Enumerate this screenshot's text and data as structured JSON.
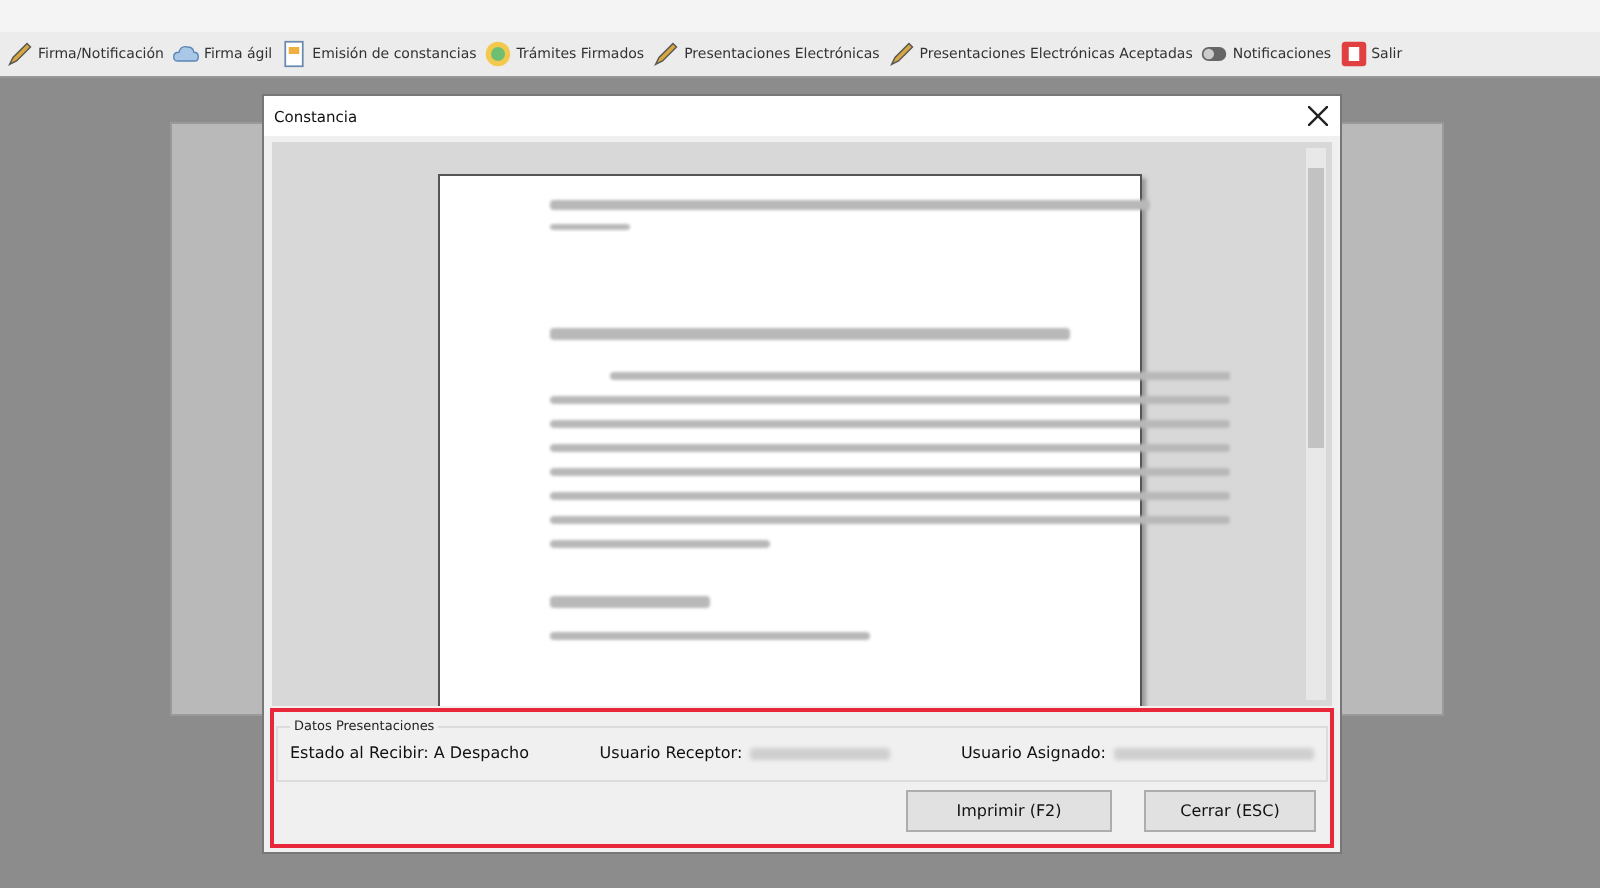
{
  "toolbar": [
    {
      "label": "Firma/Notificación",
      "kind": "pen"
    },
    {
      "label": "Firma ágil",
      "kind": "cloud"
    },
    {
      "label": "Emisión de constancias",
      "kind": "doc"
    },
    {
      "label": "Trámites Firmados",
      "kind": "badge"
    },
    {
      "label": "Presentaciones Electrónicas",
      "kind": "pen"
    },
    {
      "label": "Presentaciones Electrónicas Aceptadas",
      "kind": "pen"
    },
    {
      "label": "Notificaciones",
      "kind": "toggle"
    },
    {
      "label": "Salir",
      "kind": "exit"
    }
  ],
  "dialog": {
    "title": "Constancia",
    "group": {
      "title": "Datos Presentaciones",
      "fields": [
        {
          "label": "Estado al Recibir: A Despacho",
          "redacted": false
        },
        {
          "label": "Usuario Receptor:",
          "redacted": true
        },
        {
          "label": "Usuario Asignado:",
          "redacted": true
        }
      ]
    },
    "buttons": [
      "Imprimir (F2)",
      "Cerrar (ESC)"
    ]
  }
}
